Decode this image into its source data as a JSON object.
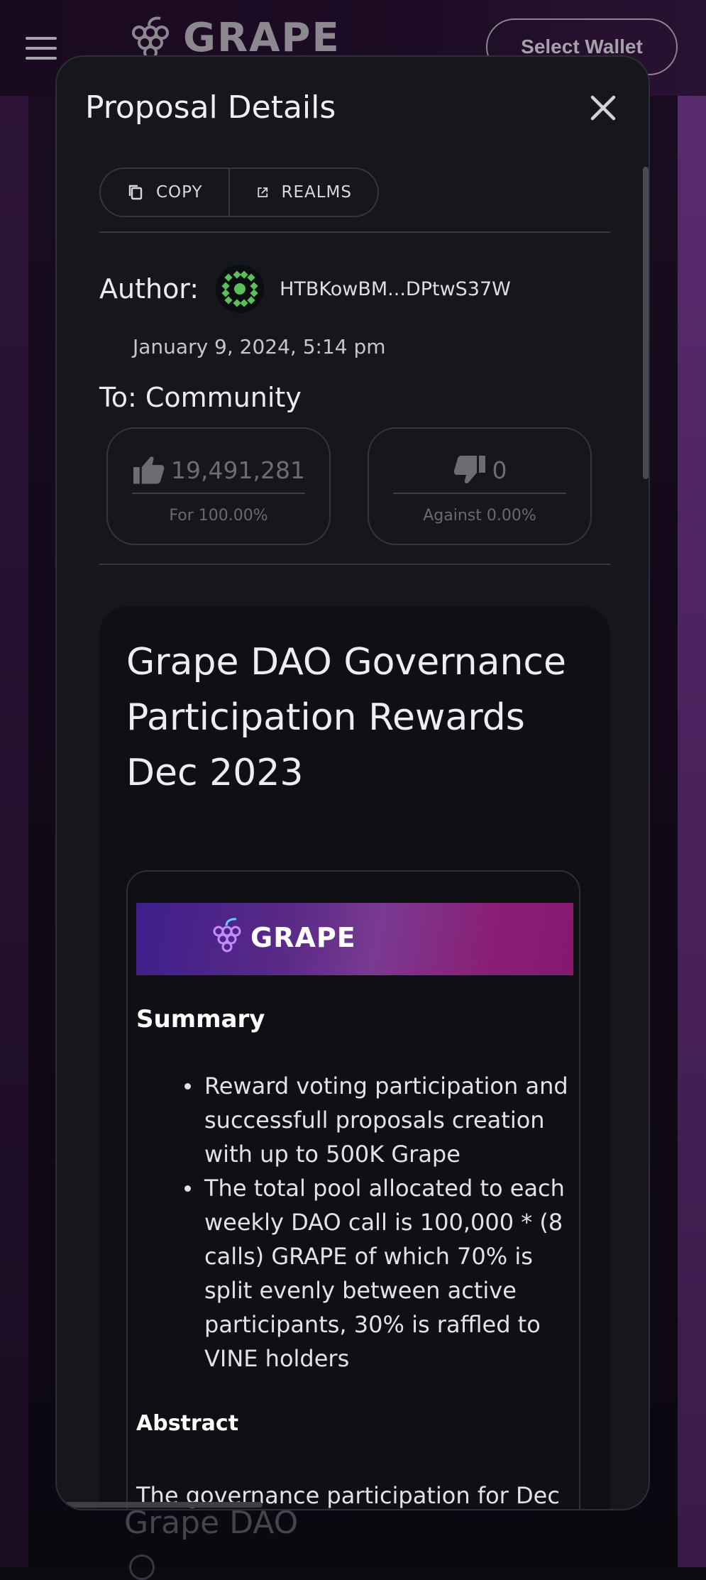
{
  "app": {
    "brand_name": "GRAPE",
    "select_wallet_label": "Select Wallet",
    "behind_text": "Grape DAO"
  },
  "modal": {
    "title": "Proposal Details",
    "copy_label": "COPY",
    "realms_label": "REALMS",
    "author_label": "Author:",
    "author_address": "HTBKowBM...DPtwS37W",
    "date": "January 9, 2024, 5:14 pm",
    "to_line": "To: Community",
    "votes": {
      "for_count": "19,491,281",
      "for_label": "For 100.00%",
      "against_count": "0",
      "against_label": "Against 0.00%"
    }
  },
  "description": {
    "title": "Grape DAO Governance Participation Rewards Dec 2023",
    "banner_text": "GRAPE",
    "summary_heading": "Summary",
    "summary_items": [
      "Reward voting participation and successfull proposals creation with up to 500K Grape",
      "The total pool allocated to each weekly DAO call is 100,000 * (8 calls) GRAPE of which 70% is split evenly between active participants, 30% is raffled to VINE holders"
    ],
    "abstract_heading": "Abstract",
    "abstract_text": "The governance participation for Dec"
  },
  "colors": {
    "modal_bg": "#15171c",
    "accent_purple": "#7a3a92",
    "avatar_green": "#5bbf5b"
  },
  "icons": {
    "menu": "hamburger-menu-icon",
    "brand": "grape-logo-icon",
    "close": "close-icon",
    "copy": "copy-icon",
    "realms": "open-in-new-icon",
    "thumb_up": "thumb-up-icon",
    "thumb_down": "thumb-down-icon"
  }
}
